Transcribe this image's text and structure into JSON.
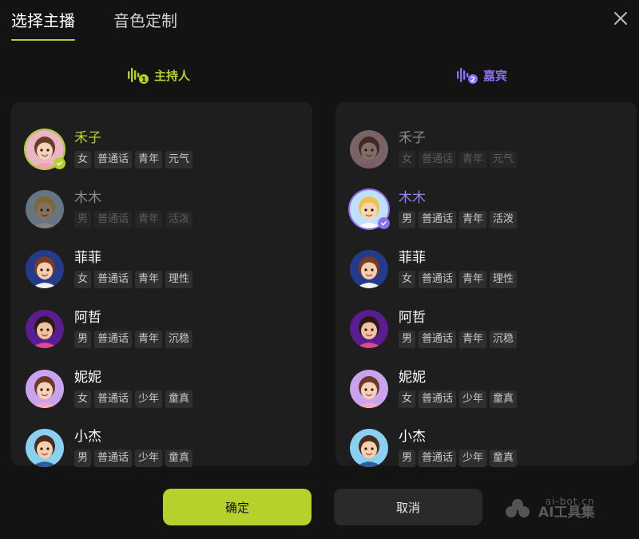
{
  "tabs": [
    "选择主播",
    "音色定制"
  ],
  "columns": {
    "host": {
      "label": "主持人",
      "badge_num": "1",
      "color": "#b5d12c"
    },
    "guest": {
      "label": "嘉宾",
      "badge_num": "2",
      "color": "#8c6ff2"
    }
  },
  "voices": [
    {
      "name": "禾子",
      "tags": [
        "女",
        "普通话",
        "青年",
        "元气"
      ]
    },
    {
      "name": "木木",
      "tags": [
        "男",
        "普通话",
        "青年",
        "活泼"
      ]
    },
    {
      "name": "菲菲",
      "tags": [
        "女",
        "普通话",
        "青年",
        "理性"
      ]
    },
    {
      "name": "阿哲",
      "tags": [
        "男",
        "普通话",
        "青年",
        "沉稳"
      ]
    },
    {
      "name": "妮妮",
      "tags": [
        "女",
        "普通话",
        "少年",
        "童真"
      ]
    },
    {
      "name": "小杰",
      "tags": [
        "男",
        "普通话",
        "少年",
        "童真"
      ]
    }
  ],
  "selection": {
    "host": "禾子",
    "guest": "木木"
  },
  "buttons": {
    "confirm": "确定",
    "cancel": "取消"
  },
  "watermark": {
    "line1": "ai-bot.cn",
    "line2": "AI工具集"
  }
}
